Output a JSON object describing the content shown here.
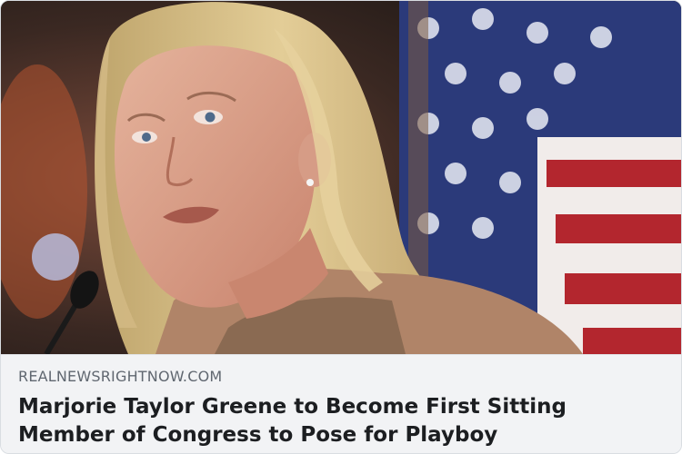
{
  "link_preview": {
    "image": {
      "description_icon": "news-photo",
      "colors": {
        "flag_blue": "#2b3a7a",
        "flag_red": "#b3262e",
        "hair": "#d9c08a",
        "skin": "#d79a84"
      }
    },
    "domain": "REALNEWSRIGHTNOW.COM",
    "headline_line1": "Marjorie Taylor Greene to Become First Sitting",
    "headline_line2": "Member of Congress to Pose for Playboy"
  }
}
